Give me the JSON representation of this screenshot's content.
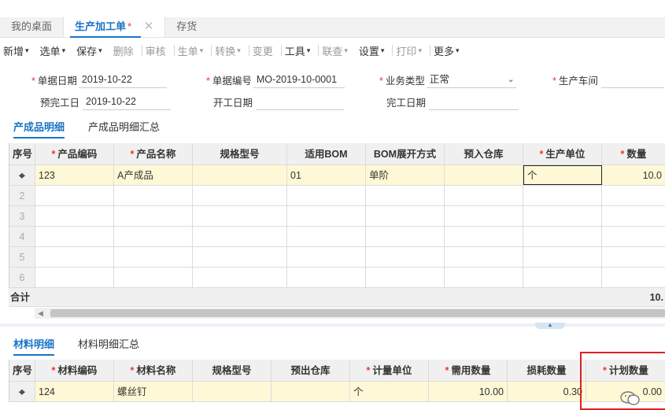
{
  "tabs": [
    {
      "label": "我的桌面"
    },
    {
      "label": "生产加工单",
      "star": "*",
      "close": "✕"
    },
    {
      "label": "存货"
    }
  ],
  "toolbar": [
    {
      "label": "新增",
      "caret": true,
      "disabled": false
    },
    {
      "label": "选单",
      "caret": true,
      "disabled": false
    },
    {
      "label": "保存",
      "caret": true,
      "disabled": false
    },
    {
      "label": "删除",
      "caret": false,
      "disabled": true
    },
    {
      "label": "审核",
      "caret": false,
      "disabled": true
    },
    {
      "label": "生单",
      "caret": true,
      "disabled": true
    },
    {
      "label": "转换",
      "caret": true,
      "disabled": true
    },
    {
      "label": "变更",
      "caret": false,
      "disabled": true
    },
    {
      "label": "工具",
      "caret": true,
      "disabled": false
    },
    {
      "label": "联查",
      "caret": true,
      "disabled": true
    },
    {
      "label": "设置",
      "caret": true,
      "disabled": false
    },
    {
      "label": "打印",
      "caret": true,
      "disabled": true
    },
    {
      "label": "更多",
      "caret": true,
      "disabled": false
    }
  ],
  "form": {
    "doc_date_label": "单据日期",
    "doc_date": "2019-10-22",
    "doc_no_label": "单据编号",
    "doc_no": "MO-2019-10-0001",
    "biz_type_label": "业务类型",
    "biz_type": "正常",
    "workshop_label": "生产车间",
    "workshop": "",
    "plan_finish_label": "预完工日",
    "plan_finish": "2019-10-22",
    "start_label": "开工日期",
    "start": "",
    "finish_label": "完工日期",
    "finish": ""
  },
  "section1_tabs": [
    "产成品明细",
    "产成品明细汇总"
  ],
  "grid1": {
    "headers": [
      "序号",
      "产品编码",
      "产品名称",
      "规格型号",
      "适用BOM",
      "BOM展开方式",
      "预入仓库",
      "生产单位",
      "数量"
    ],
    "required": [
      false,
      true,
      true,
      false,
      false,
      false,
      false,
      true,
      true
    ],
    "rows": [
      [
        "",
        "123",
        "A产成品",
        "",
        "01",
        "单阶",
        "",
        "个",
        "10.0"
      ],
      [
        "2",
        "",
        "",
        "",
        "",
        "",
        "",
        "",
        ""
      ],
      [
        "3",
        "",
        "",
        "",
        "",
        "",
        "",
        "",
        ""
      ],
      [
        "4",
        "",
        "",
        "",
        "",
        "",
        "",
        "",
        ""
      ],
      [
        "5",
        "",
        "",
        "",
        "",
        "",
        "",
        "",
        ""
      ],
      [
        "6",
        "",
        "",
        "",
        "",
        "",
        "",
        "",
        ""
      ]
    ],
    "total_label": "合计",
    "total_value": "10."
  },
  "section2_tabs": [
    "材料明细",
    "材料明细汇总"
  ],
  "grid2": {
    "headers": [
      "序号",
      "材料编码",
      "材料名称",
      "规格型号",
      "预出仓库",
      "计量单位",
      "需用数量",
      "损耗数量",
      "计划数量"
    ],
    "required": [
      false,
      true,
      true,
      false,
      false,
      true,
      true,
      false,
      true
    ],
    "rows": [
      [
        "",
        "124",
        "螺丝钉",
        "",
        "",
        "个",
        "10.00",
        "0.30",
        "0.00"
      ]
    ]
  },
  "icons": {
    "row_icon": "row-insert-icon",
    "caret": "▾",
    "scroll_left": "◀",
    "collapse": "▲"
  }
}
